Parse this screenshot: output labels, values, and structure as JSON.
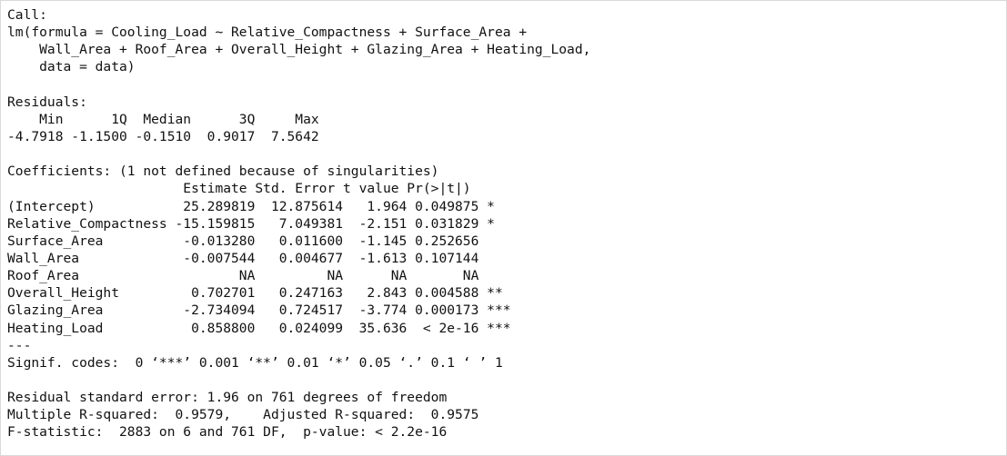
{
  "lines": [
    "Call:",
    "lm(formula = Cooling_Load ~ Relative_Compactness + Surface_Area + ",
    "    Wall_Area + Roof_Area + Overall_Height + Glazing_Area + Heating_Load, ",
    "    data = data)",
    "",
    "Residuals:",
    "    Min      1Q  Median      3Q     Max ",
    "-4.7918 -1.1500 -0.1510  0.9017  7.5642 ",
    "",
    "Coefficients: (1 not defined because of singularities)",
    "                      Estimate Std. Error t value Pr(>|t|)    ",
    "(Intercept)           25.289819  12.875614   1.964 0.049875 *  ",
    "Relative_Compactness -15.159815   7.049381  -2.151 0.031829 *  ",
    "Surface_Area          -0.013280   0.011600  -1.145 0.252656    ",
    "Wall_Area             -0.007544   0.004677  -1.613 0.107144    ",
    "Roof_Area                    NA         NA      NA       NA    ",
    "Overall_Height         0.702701   0.247163   2.843 0.004588 ** ",
    "Glazing_Area          -2.734094   0.724517  -3.774 0.000173 ***",
    "Heating_Load           0.858800   0.024099  35.636  < 2e-16 ***",
    "---",
    "Signif. codes:  0 ‘***’ 0.001 ‘**’ 0.01 ‘*’ 0.05 ‘.’ 0.1 ‘ ’ 1",
    "",
    "Residual standard error: 1.96 on 761 degrees of freedom",
    "Multiple R-squared:  0.9579,\tAdjusted R-squared:  0.9575 ",
    "F-statistic:  2883 on 6 and 761 DF,  p-value: < 2.2e-16"
  ]
}
